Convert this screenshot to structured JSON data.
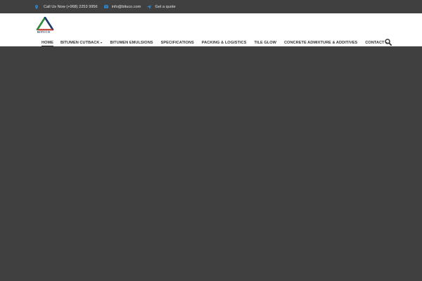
{
  "topbar": {
    "phone": "Call Us Now (+968) 2253 9956",
    "email": "info@bituco.com",
    "quote": "Get a quote"
  },
  "logo": {
    "text": "BITUCO"
  },
  "nav": {
    "items": [
      {
        "label": "Home",
        "active": true,
        "dropdown": false
      },
      {
        "label": "Bitumen Cutback",
        "active": false,
        "dropdown": true
      },
      {
        "label": "Bitumen Emulsions",
        "active": false,
        "dropdown": false
      },
      {
        "label": "Specifications",
        "active": false,
        "dropdown": false
      },
      {
        "label": "Packing & Logistics",
        "active": false,
        "dropdown": false
      },
      {
        "label": "Tile Glow",
        "active": false,
        "dropdown": false
      },
      {
        "label": "Concrete Admixture & Additives",
        "active": false,
        "dropdown": false
      },
      {
        "label": "Contact",
        "active": false,
        "dropdown": true
      }
    ]
  },
  "colors": {
    "topbar_bg": "#404040",
    "header_bg": "#ffffff",
    "icon_blue": "#2a8ad6",
    "logo_green": "#2e8b3a",
    "logo_blue": "#1e3a6e",
    "logo_red": "#c0392b",
    "body_bg": "#404040"
  },
  "icons": {
    "phone": "map-marker-icon",
    "email": "envelope-icon",
    "quote": "paper-plane-icon",
    "search": "search-icon"
  }
}
